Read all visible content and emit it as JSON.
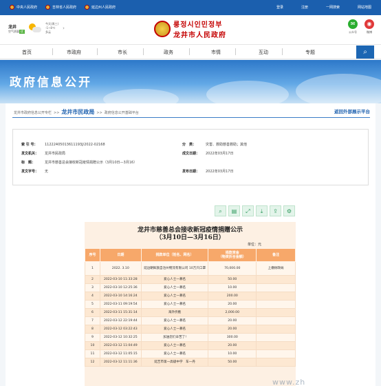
{
  "topbar": {
    "links": [
      "中央人民政府",
      "吉林省人民政府",
      "延边州人民政府"
    ],
    "right": [
      "登录",
      "注册",
      "一网搜索",
      "网站地图"
    ]
  },
  "header": {
    "weather": {
      "city": "龙井",
      "aq_label": "空气质量",
      "aq_value": "优",
      "line1": "今天(周三)",
      "line2": "-1~8℃",
      "line3": "多云"
    },
    "brand_line1": "룽정시인민정부",
    "brand_line2": "龙井市人民政府",
    "social": [
      "公众号",
      "微博"
    ]
  },
  "nav": {
    "items": [
      "首页",
      "市政府",
      "市长",
      "政务",
      "市情",
      "互动",
      "专题"
    ]
  },
  "banner": {
    "title": "政府信息公开"
  },
  "breadcrumb": {
    "part1": "龙井市政府信息公开专栏",
    "sep1": ">>",
    "current": "龙井市民政局",
    "sep2": ">>",
    "part3": "政府信息公开基础平台"
  },
  "back_link": "返回外部展示平台",
  "meta": {
    "index_label": "索 引 号：",
    "index_value": "11222405013611193J/2022-02168",
    "category_label": "分　类：",
    "category_value": "灾害、救助慈善救助；其他",
    "issuer_label": "发文机关：",
    "issuer_value": "龙井市民政局",
    "created_label": "成文日期：",
    "created_value": "2022年03月17日",
    "title_label": "标　题：",
    "title_value": "龙井市慈善总会接收新冠疫情捐赠公示（3月10日—3月16）",
    "docno_label": "发文字号：",
    "docno_value": "无",
    "published_label": "发布日期：",
    "published_value": "2022年03月17日"
  },
  "tools": [
    "search-doc",
    "word",
    "fullscreen",
    "download",
    "share",
    "settings"
  ],
  "document": {
    "title1": "龙井市慈善总会接收新冠疫情捐赠公示",
    "title2": "（3月10日—3月16日）",
    "unit": "单位：元",
    "headers": [
      "序号",
      "日期",
      "捐款单位（姓名、网名）",
      "捐款资金\n（物资折合金额）",
      "备注"
    ],
    "rows": [
      [
        "1",
        "2022. 3.10",
        "延边朝鲜族自治州物流有限公司 10万只口罩",
        "70,000.00",
        "上缴财政局"
      ],
      [
        "2",
        "2022-03-10 11:33:28",
        "爱心人士一慕名",
        "50.00",
        ""
      ],
      [
        "3",
        "2022-03-10 12:25:36",
        "爱心人士一慕名",
        "10.00",
        ""
      ],
      [
        "4",
        "2022-03-10 14:16:24",
        "爱心人士一慕名",
        "200.00",
        ""
      ],
      [
        "5",
        "2022-03-11 09:19:54",
        "爱心人士一慕名",
        "20.00",
        ""
      ],
      [
        "6",
        "2022-03-11 15:31:14",
        "海外侨胞",
        "2,000.00",
        ""
      ],
      [
        "7",
        "2022-03-12 22:19:44",
        "爱心人士一慕名",
        "20.00",
        ""
      ],
      [
        "8",
        "2022-03-12 03:22:43",
        "爱心人士一慕名",
        "20.00",
        ""
      ],
      [
        "9",
        "2022-03-12 10:32:25",
        "加油您们辛苦了!",
        "300.00",
        ""
      ],
      [
        "10",
        "2022-03-12 11:04:49",
        "爱心人士一慕名",
        "20.00",
        ""
      ],
      [
        "11",
        "2022-03-12 11:05:15",
        "爱心人士一慕名",
        "10.00",
        ""
      ],
      [
        "12",
        "2022-03-12 11:11:36",
        "延吉市第一高级中学　车一丹",
        "50.00",
        ""
      ]
    ]
  },
  "watermark": "www.zh"
}
